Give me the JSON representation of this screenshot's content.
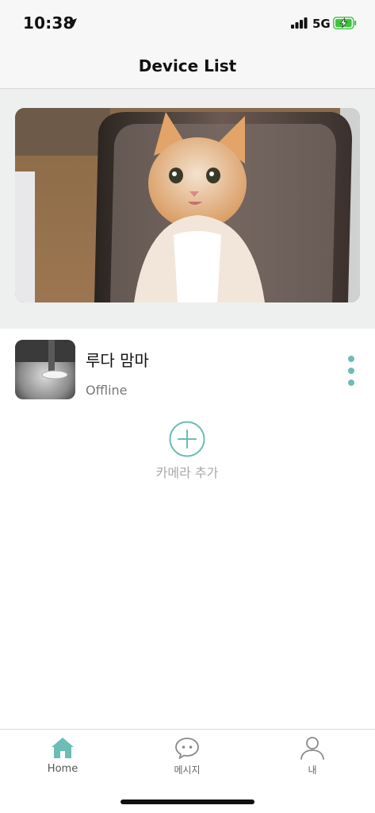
{
  "status_bar": {
    "time": "10:38",
    "network": "5G",
    "icons": [
      "location-arrow-icon",
      "signal-icon",
      "battery-charging-icon"
    ]
  },
  "header": {
    "title": "Device List"
  },
  "banner": {
    "image_alt": "kitten-on-chair-photo"
  },
  "devices": [
    {
      "name": "루다 맘마",
      "status": "Offline",
      "thumbnail": "camera-night-view-thumbnail"
    }
  ],
  "add_camera": {
    "label": "카메라 추가"
  },
  "tabs": [
    {
      "label": "Home",
      "icon": "home-icon",
      "active": true
    },
    {
      "label": "메시지",
      "icon": "chat-bubble-icon",
      "active": false
    },
    {
      "label": "내",
      "icon": "person-icon",
      "active": false
    }
  ],
  "colors": {
    "accent": "#6cbdb5",
    "banner_bg": "#eef0f0",
    "bar_bg": "#f7f7f7",
    "battery_green": "#3ec43e"
  }
}
